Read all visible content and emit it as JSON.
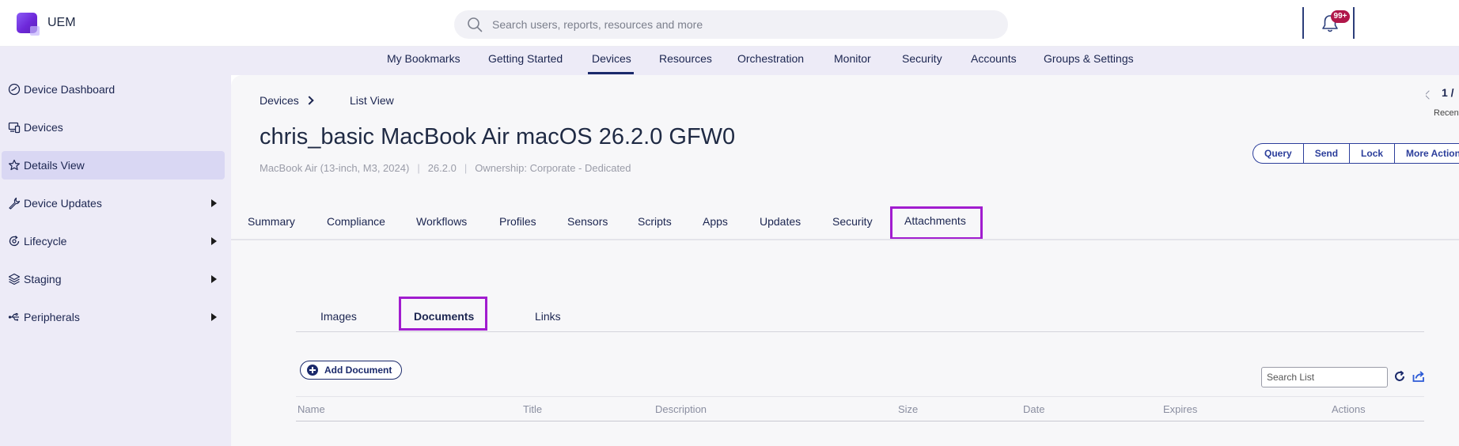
{
  "app": {
    "name": "UEM"
  },
  "search": {
    "placeholder": "Search users, reports, resources and more"
  },
  "notifications": {
    "badge": "99+"
  },
  "nav": {
    "items": [
      "My Bookmarks",
      "Getting Started",
      "Devices",
      "Resources",
      "Orchestration",
      "Monitor",
      "Security",
      "Accounts",
      "Groups & Settings"
    ],
    "active": "Devices"
  },
  "sidebar": {
    "items": [
      {
        "label": "Device Dashboard",
        "icon": "dashboard-icon"
      },
      {
        "label": "Devices",
        "icon": "devices-icon"
      },
      {
        "label": "Details View",
        "icon": "star-icon",
        "active": true
      },
      {
        "label": "Device Updates",
        "icon": "wrench-icon",
        "expandable": true
      },
      {
        "label": "Lifecycle",
        "icon": "lifecycle-icon",
        "expandable": true
      },
      {
        "label": "Staging",
        "icon": "layers-icon",
        "expandable": true
      },
      {
        "label": "Peripherals",
        "icon": "usb-icon",
        "expandable": true
      }
    ]
  },
  "breadcrumb": {
    "root": "Devices",
    "current": "List View"
  },
  "device": {
    "title": "chris_basic MacBook Air macOS 26.2.0 GFW0",
    "model": "MacBook Air (13-inch, M3, 2024)",
    "os_version": "26.2.0",
    "ownership": "Ownership: Corporate - Dedicated"
  },
  "pager": {
    "number": "1 /",
    "recent": "Recent"
  },
  "actions": [
    "Query",
    "Send",
    "Lock",
    "More Actions"
  ],
  "tabs": [
    "Summary",
    "Compliance",
    "Workflows",
    "Profiles",
    "Sensors",
    "Scripts",
    "Apps",
    "Updates",
    "Security",
    "Attachments"
  ],
  "active_tab": "Attachments",
  "subtabs": [
    "Images",
    "Documents",
    "Links"
  ],
  "active_subtab": "Documents",
  "documents": {
    "add_label": "Add Document",
    "search_placeholder": "Search List",
    "columns": [
      "Name",
      "Title",
      "Description",
      "Size",
      "Date",
      "Expires",
      "Actions"
    ]
  },
  "colors": {
    "accent": "#1b2a6b",
    "highlight": "#a11ccf",
    "badge": "#b0174a",
    "nav_bg": "#edebf7"
  }
}
